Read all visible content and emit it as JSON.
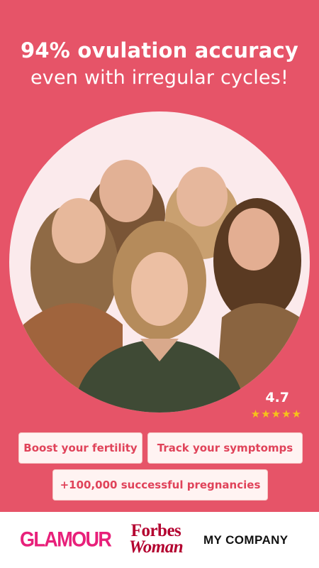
{
  "headline": {
    "line1": "94% ovulation accuracy",
    "line2": "even with irregular cycles!"
  },
  "rating": {
    "value": "4.7",
    "stars": "★★★★★",
    "star_count": 5
  },
  "chips": [
    {
      "label": "Boost your fertility"
    },
    {
      "label": "Track your symptomps"
    },
    {
      "label": "+100,000 successful pregnancies"
    }
  ],
  "press": {
    "logos": [
      "GLAMOUR",
      "Forbes",
      "Woman",
      "MY COMPANY"
    ]
  },
  "colors": {
    "background": "#e65468",
    "chip_text": "#e0435a",
    "chip_bg": "#fff3f2",
    "star": "#f6c21a",
    "glamour": "#e8207a",
    "forbes": "#b3002f"
  }
}
